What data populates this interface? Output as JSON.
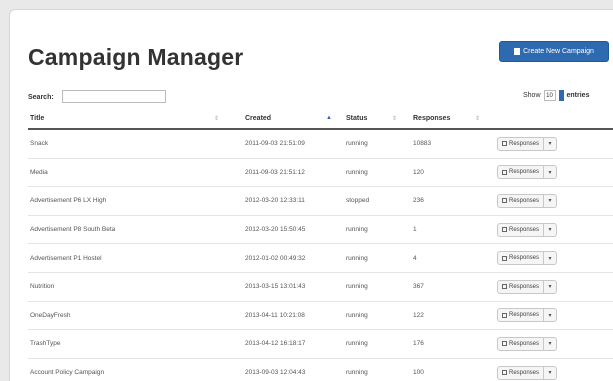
{
  "header": {
    "title": "Campaign Manager",
    "create_button_label": "Create New Campaign",
    "create_icon": "document-icon",
    "accent_color": "#2d6ab0"
  },
  "controls": {
    "search_label": "Search:",
    "search_value": "",
    "show_label": "Show",
    "show_value": "10",
    "entries_label": "entries"
  },
  "table": {
    "columns": [
      "Title",
      "Created",
      "Status",
      "Responses",
      ""
    ],
    "action_label": "Responses",
    "action_caret": "▾",
    "rows": [
      {
        "title": "Snack",
        "created": "2011-09-03 21:51:09",
        "status": "running",
        "responses": "10883"
      },
      {
        "title": "Media",
        "created": "2011-09-03 21:51:12",
        "status": "running",
        "responses": "120"
      },
      {
        "title": "Advertisement P6 LX High",
        "created": "2012-03-20 12:33:11",
        "status": "stopped",
        "responses": "236"
      },
      {
        "title": "Advertisement P8 South Beta",
        "created": "2012-03-20 15:50:45",
        "status": "running",
        "responses": "1"
      },
      {
        "title": "Advertisement P1 Hostel",
        "created": "2012-01-02 00:49:32",
        "status": "running",
        "responses": "4"
      },
      {
        "title": "Nutrition",
        "created": "2013-03-15 13:01:43",
        "status": "running",
        "responses": "367"
      },
      {
        "title": "OneDayFresh",
        "created": "2013-04-11 10:21:08",
        "status": "running",
        "responses": "122"
      },
      {
        "title": "TrashType",
        "created": "2013-04-12 16:18:17",
        "status": "running",
        "responses": "176"
      },
      {
        "title": "Account Policy Campaign",
        "created": "2013-09-03 12:04:43",
        "status": "running",
        "responses": "100"
      }
    ]
  }
}
